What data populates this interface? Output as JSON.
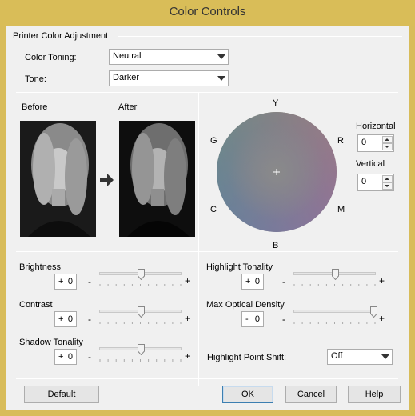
{
  "window": {
    "title": "Color Controls"
  },
  "adjustment": {
    "group_title": "Printer Color Adjustment",
    "color_toning_label": "Color Toning:",
    "color_toning_value": "Neutral",
    "tone_label": "Tone:",
    "tone_value": "Darker"
  },
  "preview": {
    "before_label": "Before",
    "after_label": "After"
  },
  "color_wheel": {
    "labels": {
      "top": "Y",
      "top_right": "R",
      "right": "M",
      "bottom": "B",
      "left": "C",
      "top_left": "G"
    },
    "horizontal_label": "Horizontal",
    "horizontal_value": "0",
    "vertical_label": "Vertical",
    "vertical_value": "0"
  },
  "sliders_left": [
    {
      "label": "Brightness",
      "sign": "+",
      "value": "0",
      "level": 0.5
    },
    {
      "label": "Contrast",
      "sign": "+",
      "value": "0",
      "level": 0.5
    },
    {
      "label": "Shadow Tonality",
      "sign": "+",
      "value": "0",
      "level": 0.5
    }
  ],
  "sliders_right": [
    {
      "label": "Highlight Tonality",
      "sign": "+",
      "value": "0",
      "level": 0.5
    },
    {
      "label": "Max Optical Density",
      "sign": "-",
      "value": "0",
      "level": 0.97
    }
  ],
  "slider_min_symbol": "-",
  "slider_max_symbol": "+",
  "highlight_point_shift": {
    "label": "Highlight Point Shift:",
    "value": "Off"
  },
  "buttons": {
    "default": "Default",
    "ok": "OK",
    "cancel": "Cancel",
    "help": "Help"
  }
}
